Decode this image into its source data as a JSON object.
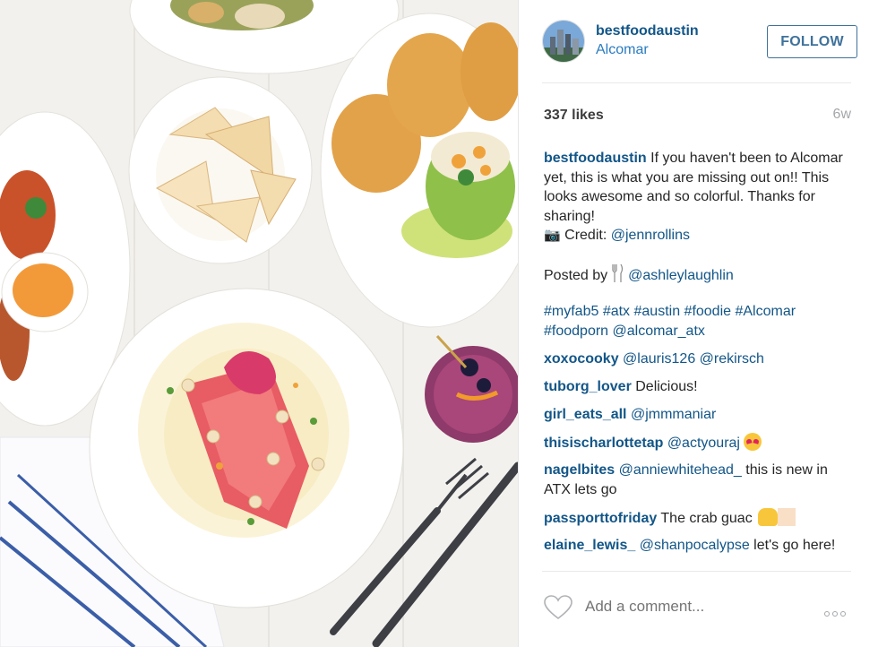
{
  "post": {
    "username": "bestfoodaustin",
    "location": "Alcomar",
    "follow_label": "FOLLOW",
    "likes": "337 likes",
    "age": "6w"
  },
  "caption": {
    "username": "bestfoodaustin",
    "text": " If you haven't been to Alcomar yet, this is what you are missing out on!! This looks awesome and so colorful. Thanks for sharing!",
    "camera_emoji": "📷",
    "credit_label": " Credit: ",
    "credit_handle": "@jennrollins",
    "posted_by_label": "Posted by",
    "posted_by_handle": "@ashleylaughlin",
    "hashtags": "#myfab5 #atx #austin #foodie #Alcomar #foodporn @alcomar_atx"
  },
  "comments": [
    {
      "user": "xoxocooky",
      "text": " ",
      "mention": "@lauris126 @rekirsch"
    },
    {
      "user": "tuborg_lover",
      "text": " Delicious!",
      "mention": ""
    },
    {
      "user": "girl_eats_all",
      "text": " ",
      "mention": "@jmmmaniar"
    },
    {
      "user": "thisischarlottetap",
      "text": " ",
      "mention": "@actyouraj"
    },
    {
      "user": "nagelbites",
      "text": " this is new in ATX lets go",
      "mention": "@anniewhitehead_"
    },
    {
      "user": "passporttofriday",
      "text": " The crab guac ",
      "mention": ""
    },
    {
      "user": "elaine_lewis_",
      "text": " let's go here!",
      "mention": "@shanpocalypse"
    }
  ],
  "footer": {
    "comment_placeholder": "Add a comment..."
  },
  "icons": {
    "avatar": "city-skyline-avatar",
    "like": "heart-outline-icon",
    "more": "more-options-icon",
    "fork_knife": "fork-knife-icon"
  },
  "colors": {
    "username": "#125688",
    "follow_border": "#3f729b",
    "muted": "#a5a7aa"
  }
}
